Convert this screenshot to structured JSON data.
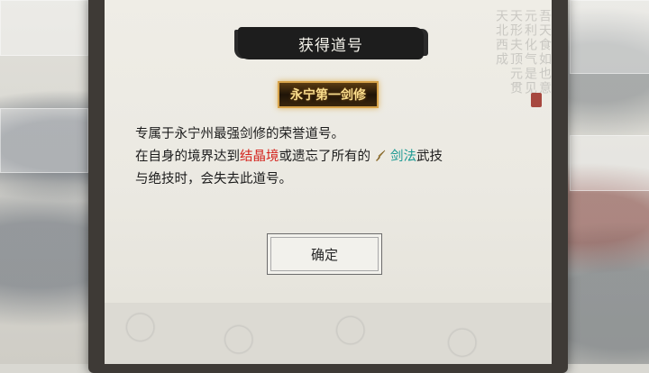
{
  "dialog": {
    "title": "获得道号",
    "badge": "永宁第一剑修",
    "line1": "专属于永宁州最强剑修的荣誉道号。",
    "line2_pre": "在自身的境界达到",
    "line2_realm": "结晶境",
    "line2_mid": "或遗忘了所有的",
    "line2_skill": "剑法",
    "line2_post": "武技",
    "line3": "与绝技时，会失去此道号。",
    "confirm_label": "确定"
  },
  "decor": {
    "calligraphy": "吾天食如也意元利化气是见天形夫顶元贯天北西成"
  },
  "icons": {
    "skill_icon": "sword-icon"
  },
  "colors": {
    "realm_text": "#d4231c",
    "skill_text": "#1c9a93",
    "badge_text": "#f8dc8c"
  }
}
